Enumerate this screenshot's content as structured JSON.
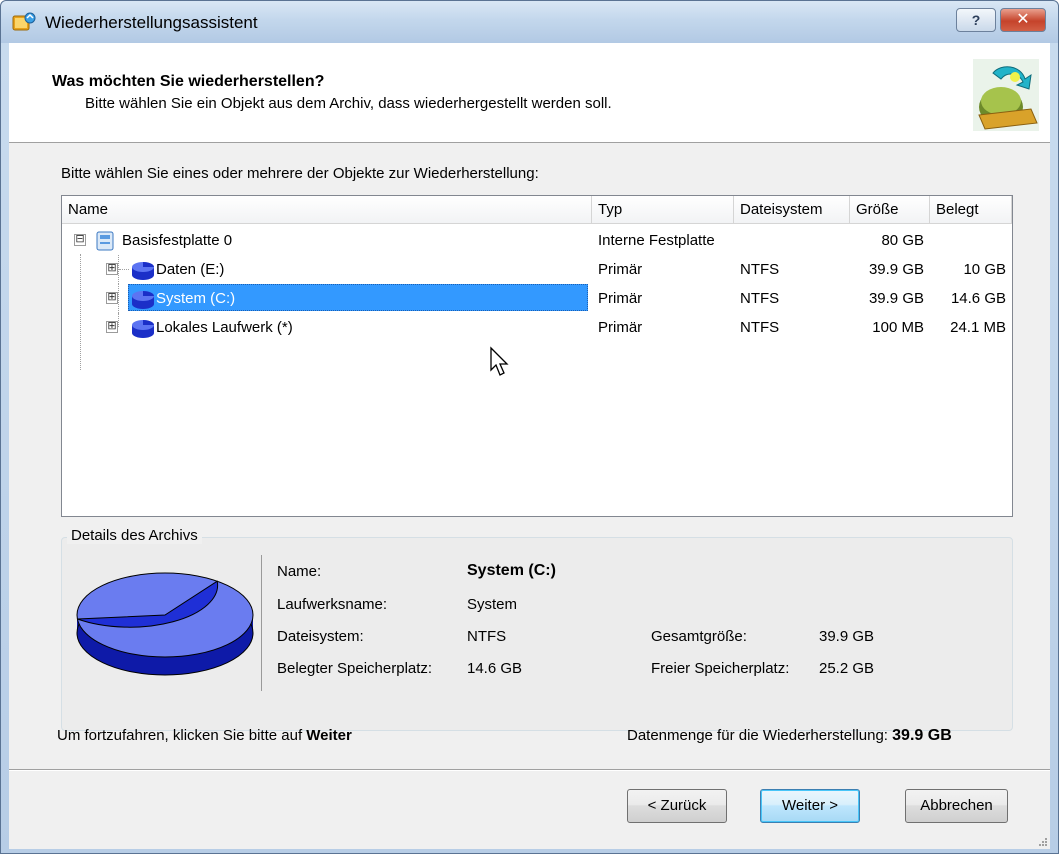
{
  "window": {
    "title": "Wiederherstellungsassistent",
    "help_label": "?",
    "close_label": "✕"
  },
  "header": {
    "title": "Was möchten Sie wiederherstellen?",
    "subtitle": "Bitte wählen Sie ein Objekt aus dem Archiv, dass wiederhergestellt werden soll."
  },
  "prompt": "Bitte wählen Sie eines oder mehrere der Objekte zur Wiederherstellung:",
  "table": {
    "columns": [
      "Name",
      "Typ",
      "Dateisystem",
      "Größe",
      "Belegt"
    ],
    "rows": [
      {
        "name": "Basisfestplatte 0",
        "typ": "Interne Festplatte",
        "fs": "",
        "size": "80 GB",
        "used": "",
        "icon": "hard-disk-icon",
        "expander": "⊟"
      },
      {
        "name": "Daten (E:)",
        "typ": "Primär",
        "fs": "NTFS",
        "size": "39.9 GB",
        "used": "10 GB",
        "icon": "partition-icon",
        "expander": "⊞"
      },
      {
        "name": "System (C:)",
        "typ": "Primär",
        "fs": "NTFS",
        "size": "39.9 GB",
        "used": "14.6 GB",
        "icon": "partition-icon",
        "expander": "⊞",
        "selected": true
      },
      {
        "name": "Lokales Laufwerk (*)",
        "typ": "Primär",
        "fs": "NTFS",
        "size": "100 MB",
        "used": "24.1 MB",
        "icon": "partition-icon",
        "expander": "⊞"
      }
    ]
  },
  "details": {
    "legend": "Details des Archivs",
    "name_label": "Name:",
    "name_value": "System (C:)",
    "drive_label": "Laufwerksname:",
    "drive_value": "System",
    "fs_label": "Dateisystem:",
    "fs_value": "NTFS",
    "used_label": "Belegter Speicherplatz:",
    "used_value": "14.6 GB",
    "total_label": "Gesamtgröße:",
    "total_value": "39.9 GB",
    "free_label": "Freier Speicherplatz:",
    "free_value": "25.2 GB",
    "used_fraction": 0.366
  },
  "footer": {
    "hint_prefix": "Um fortzufahren, klicken Sie bitte auf ",
    "hint_bold": "Weiter",
    "amount_label": "Datenmenge für die Wiederherstellung: ",
    "amount_value": "39.9 GB"
  },
  "buttons": {
    "back": "< Zurück",
    "next": "Weiter >",
    "cancel": "Abbrechen"
  },
  "colors": {
    "selection": "#3399ff",
    "pie_used": "#1f2fd6",
    "pie_free": "#6a7cf0"
  }
}
